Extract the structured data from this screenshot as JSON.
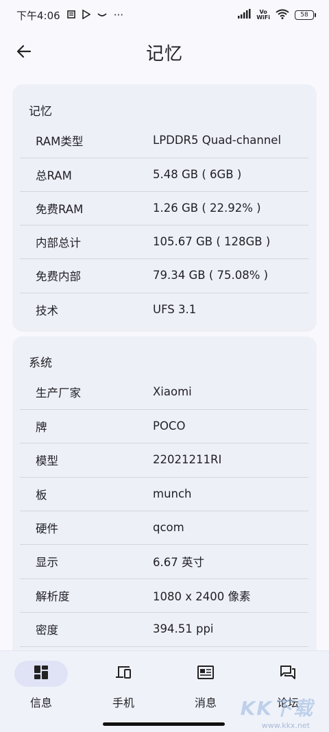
{
  "status_bar": {
    "time": "下午4:06",
    "more": "···",
    "wifi_label_top": "Vo",
    "wifi_label_bottom": "WiFi",
    "battery": "58"
  },
  "app_bar": {
    "title": "记忆"
  },
  "memory": {
    "title": "记忆",
    "rows": [
      {
        "label": "RAM类型",
        "value": "LPDDR5 Quad-channel"
      },
      {
        "label": "总RAM",
        "value": "5.48 GB ( 6GB )"
      },
      {
        "label": "免费RAM",
        "value": "1.26 GB ( 22.92% )"
      },
      {
        "label": "内部总计",
        "value": "105.67 GB ( 128GB )"
      },
      {
        "label": "免费内部",
        "value": "79.34 GB ( 75.08% )"
      },
      {
        "label": "技术",
        "value": "UFS 3.1"
      }
    ]
  },
  "system": {
    "title": "系统",
    "rows": [
      {
        "label": "生产厂家",
        "value": "Xiaomi"
      },
      {
        "label": "牌",
        "value": "POCO"
      },
      {
        "label": "模型",
        "value": "22021211RI"
      },
      {
        "label": "板",
        "value": "munch"
      },
      {
        "label": "硬件",
        "value": "qcom"
      },
      {
        "label": "显示",
        "value": "6.67 英寸"
      },
      {
        "label": "解析度",
        "value": "1080 x 2400 像素"
      },
      {
        "label": "密度",
        "value": "394.51 ppi"
      }
    ]
  },
  "bottom_nav": {
    "items": [
      {
        "label": "信息",
        "icon": "dashboard-icon",
        "active": true
      },
      {
        "label": "手机",
        "icon": "devices-icon",
        "active": false
      },
      {
        "label": "消息",
        "icon": "newspaper-icon",
        "active": false
      },
      {
        "label": "论坛",
        "icon": "forum-icon",
        "active": false
      }
    ]
  },
  "watermark": {
    "text": "KK下载",
    "url": "www.kkx.net"
  }
}
